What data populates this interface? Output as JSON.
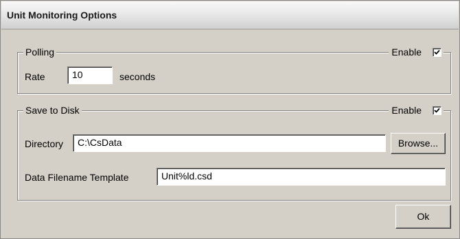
{
  "window": {
    "title": "Unit Monitoring Options"
  },
  "polling": {
    "group_label": "Polling",
    "enable_label": "Enable",
    "enabled": true,
    "rate_label": "Rate",
    "rate_value": "10",
    "rate_unit": "seconds"
  },
  "save_to_disk": {
    "group_label": "Save to Disk",
    "enable_label": "Enable",
    "enabled": true,
    "directory_label": "Directory",
    "directory_value": "C:\\CsData",
    "browse_label": "Browse...",
    "filename_template_label": "Data Filename Template",
    "filename_template_value": "Unit%ld.csd"
  },
  "buttons": {
    "ok_label": "Ok"
  }
}
